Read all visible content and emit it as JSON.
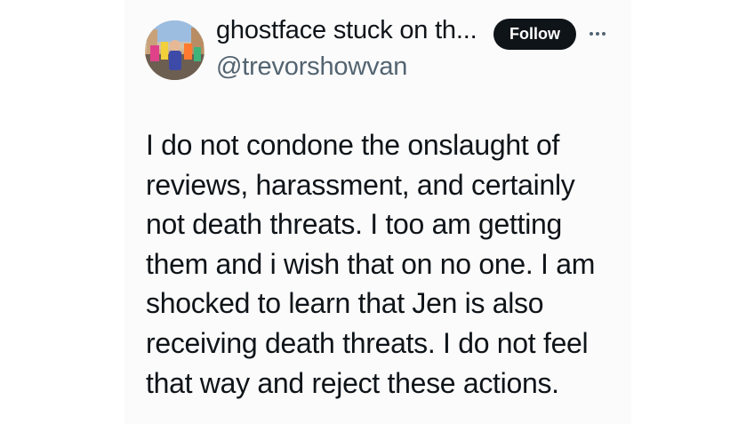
{
  "author": {
    "display_name": "ghostface stuck on th...",
    "handle": "@trevorshowvan"
  },
  "actions": {
    "follow_label": "Follow"
  },
  "icons": {
    "more": "more-horizontal-icon"
  },
  "tweet": {
    "lines": [
      "I do not condone the onslaught of",
      "reviews, harassment, and certainly",
      "not death threats. I too am getting",
      "them and i wish that on no one. I am",
      "shocked to learn that Jen is also",
      "receiving death threats. I do not feel",
      "that way and reject these actions."
    ]
  },
  "colors": {
    "text": "#0f1419",
    "secondary": "#536471",
    "follow_bg": "#0f1419",
    "card_bg": "#fbfbfb"
  }
}
